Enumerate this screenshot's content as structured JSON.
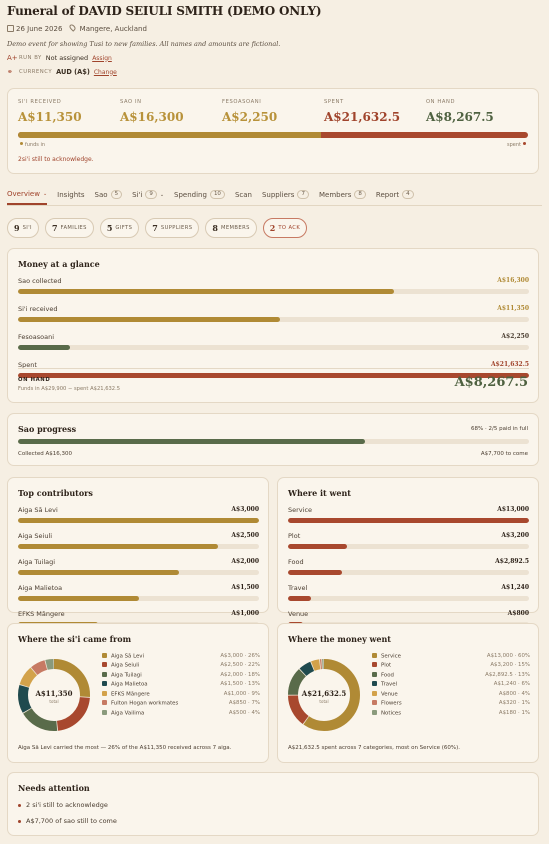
{
  "header": {
    "title": "Funeral of DAVID SEIULI SMITH (DEMO ONLY)",
    "date": "26 June 2026",
    "location": "Mangere, Auckland",
    "demo_note": "Demo event for showing Tusi to new families. All names and amounts are fictional.",
    "run_by_label": "RUN BY",
    "run_by_value": "Not assigned",
    "assign_link": "Assign",
    "currency_label": "CURRENCY",
    "currency_value": "AUD (A$)",
    "change_link": "Change"
  },
  "summary": {
    "cells": [
      {
        "label": "SI'I RECEIVED",
        "value": "A$11,350"
      },
      {
        "label": "SAO IN",
        "value": "A$16,300"
      },
      {
        "label": "FESOASOANI",
        "value": "A$2,250"
      },
      {
        "label": "SPENT",
        "value": "A$21,632.5"
      },
      {
        "label": "ON HAND",
        "value": "A$8,267.5"
      }
    ],
    "funds_in_fraction": 0.595,
    "legend_left": "funds in",
    "legend_right": "spent",
    "ack_note": "2si'i still to acknowledge."
  },
  "tabs": [
    {
      "label": "Overview",
      "count": "",
      "chevron": true,
      "active": true
    },
    {
      "label": "Insights",
      "count": "",
      "chevron": false
    },
    {
      "label": "Sao",
      "count": "5",
      "chevron": false
    },
    {
      "label": "Si'i",
      "count": "9",
      "chevron": true
    },
    {
      "label": "Spending",
      "count": "10",
      "chevron": false
    },
    {
      "label": "Scan",
      "count": "",
      "chevron": false
    },
    {
      "label": "Suppliers",
      "count": "7",
      "chevron": false
    },
    {
      "label": "Members",
      "count": "8",
      "chevron": false
    },
    {
      "label": "Report",
      "count": "4",
      "chevron": false
    }
  ],
  "pills": [
    {
      "n": "9",
      "t": "SI'I"
    },
    {
      "n": "7",
      "t": "FAMILIES"
    },
    {
      "n": "5",
      "t": "GIFTS"
    },
    {
      "n": "7",
      "t": "SUPPLIERS"
    },
    {
      "n": "8",
      "t": "MEMBERS"
    },
    {
      "n": "2",
      "t": "TO ACK"
    }
  ],
  "glance": {
    "title": "Money at a glance",
    "rows": [
      {
        "label": "Sao collected",
        "amount": "A$16,300",
        "fraction": 0.735,
        "color": "#b08a35",
        "amount_color": "#b08a35"
      },
      {
        "label": "Si'i received",
        "amount": "A$11,350",
        "fraction": 0.512,
        "color": "#b08a35",
        "amount_color": "#b08a35"
      },
      {
        "label": "Fesoasoani",
        "amount": "A$2,250",
        "fraction": 0.102,
        "color": "#596b4a",
        "amount_color": "#4a3d30"
      },
      {
        "label": "Spent",
        "amount": "A$21,632.5",
        "fraction": 1.0,
        "color": "#a8482e",
        "amount_color": "#a0442c"
      }
    ],
    "onhand_label": "ON HAND",
    "onhand_sub": "Funds in A$29,900 − spent A$21,632.5",
    "onhand_value": "A$8,267.5"
  },
  "sao": {
    "title": "Sao progress",
    "right_label": "68% · 2/5 paid in full",
    "fraction": 0.68,
    "collected": "Collected A$16,300",
    "to_come": "A$7,700 to come"
  },
  "contributors": {
    "title": "Top contributors",
    "rows": [
      {
        "label": "Aiga Sā Levi",
        "amount": "A$3,000",
        "fraction": 1.0
      },
      {
        "label": "Aiga Seiuli",
        "amount": "A$2,500",
        "fraction": 0.83
      },
      {
        "label": "Aiga Tuilagi",
        "amount": "A$2,000",
        "fraction": 0.667
      },
      {
        "label": "Aiga Malietoa",
        "amount": "A$1,500",
        "fraction": 0.5
      },
      {
        "label": "EFKS Māngere",
        "amount": "A$1,000",
        "fraction": 0.333
      }
    ]
  },
  "where_went": {
    "title": "Where it went",
    "rows": [
      {
        "label": "Service",
        "amount": "A$13,000",
        "fraction": 1.0
      },
      {
        "label": "Plot",
        "amount": "A$3,200",
        "fraction": 0.246
      },
      {
        "label": "Food",
        "amount": "A$2,892.5",
        "fraction": 0.222
      },
      {
        "label": "Travel",
        "amount": "A$1,240",
        "fraction": 0.095
      },
      {
        "label": "Venue",
        "amount": "A$800",
        "fraction": 0.062
      }
    ]
  },
  "sii_donut": {
    "title": "Where the si'i came from",
    "center_value": "A$11,350",
    "center_label": "total",
    "items": [
      {
        "label": "Aiga Sā Levi",
        "value": "A$3,000 · 26%",
        "share": 26,
        "color": "#b08a35"
      },
      {
        "label": "Aiga Seiuli",
        "value": "A$2,500 · 22%",
        "share": 22,
        "color": "#a8482e"
      },
      {
        "label": "Aiga Tuilagi",
        "value": "A$2,000 · 18%",
        "share": 18,
        "color": "#596b4a"
      },
      {
        "label": "Aiga Malietoa",
        "value": "A$1,500 · 13%",
        "share": 13,
        "color": "#1f4a4e"
      },
      {
        "label": "EFKS Māngere",
        "value": "A$1,000 · 9%",
        "share": 9,
        "color": "#d3a24a"
      },
      {
        "label": "Fulton Hogan workmates",
        "value": "A$850 · 7%",
        "share": 7,
        "color": "#c77a63"
      },
      {
        "label": "Aiga Vailima",
        "value": "A$500 · 4%",
        "share": 4,
        "color": "#8a9a7c"
      }
    ],
    "note": "Aiga Sā Levi carried the most — 26% of the A$11,350 received across 7 aiga."
  },
  "money_donut": {
    "title": "Where the money went",
    "center_value": "A$21,632.5",
    "center_label": "total",
    "items": [
      {
        "label": "Service",
        "value": "A$13,000 · 60%",
        "share": 60,
        "color": "#b08a35"
      },
      {
        "label": "Plot",
        "value": "A$3,200 · 15%",
        "share": 15,
        "color": "#a8482e"
      },
      {
        "label": "Food",
        "value": "A$2,892.5 · 13%",
        "share": 13,
        "color": "#596b4a"
      },
      {
        "label": "Travel",
        "value": "A$1,240 · 6%",
        "share": 6,
        "color": "#1f4a4e"
      },
      {
        "label": "Venue",
        "value": "A$800 · 4%",
        "share": 4,
        "color": "#d3a24a"
      },
      {
        "label": "Flowers",
        "value": "A$320 · 1%",
        "share": 1,
        "color": "#c77a63"
      },
      {
        "label": "Notices",
        "value": "A$180 · 1%",
        "share": 1,
        "color": "#8a9a7c"
      }
    ],
    "note": "A$21,632.5 spent across 7 categories, most on Service (60%)."
  },
  "attention": {
    "title": "Needs attention",
    "items": [
      "2 si'i still to acknowledge",
      "A$7,700 of sao still to come"
    ]
  }
}
